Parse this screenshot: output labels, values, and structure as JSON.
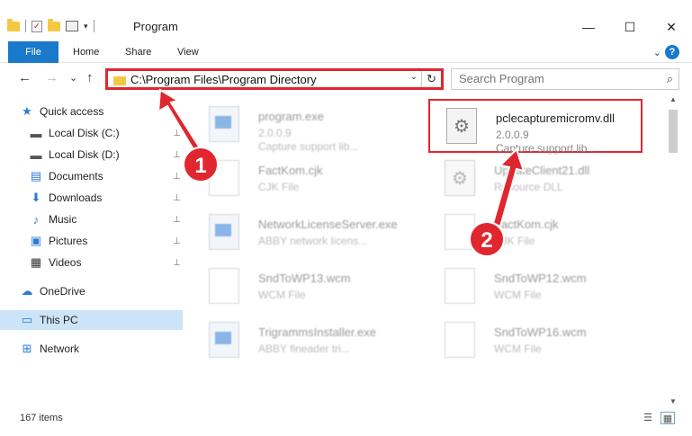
{
  "window": {
    "title": "Program",
    "minimize_glyph": "—",
    "maximize_glyph": "☐",
    "close_glyph": "✕"
  },
  "quick_access_toolbar": {
    "check_glyph": "✓",
    "dropdown_glyph": "▾"
  },
  "ribbon": {
    "tabs": [
      "File",
      "Home",
      "Share",
      "View"
    ],
    "expand_glyph": "⌄",
    "help_glyph": "?"
  },
  "nav": {
    "back_glyph": "←",
    "forward_glyph": "→",
    "recent_glyph": "⌄",
    "up_glyph": "↑"
  },
  "address": {
    "path": "C:\\Program Files\\Program Directory",
    "dropdown_glyph": "⌄",
    "refresh_glyph": "↻"
  },
  "search": {
    "placeholder": "Search Program",
    "icon_glyph": "⌕"
  },
  "sidebar": {
    "items": [
      {
        "label": "Quick access",
        "icon": "star-icon",
        "glyph": "★",
        "color": "#2a7bd3",
        "pinned": false
      },
      {
        "label": "Local Disk (C:)",
        "icon": "drive-icon",
        "glyph": "▬",
        "color": "#555555",
        "pinned": true
      },
      {
        "label": "Local Disk (D:)",
        "icon": "drive-icon",
        "glyph": "▬",
        "color": "#555555",
        "pinned": true
      },
      {
        "label": "Documents",
        "icon": "documents-icon",
        "glyph": "▤",
        "color": "#2a7bd3",
        "pinned": true
      },
      {
        "label": "Downloads",
        "icon": "download-icon",
        "glyph": "⬇",
        "color": "#2a7bd3",
        "pinned": true
      },
      {
        "label": "Music",
        "icon": "music-icon",
        "glyph": "♪",
        "color": "#2a7bd3",
        "pinned": true
      },
      {
        "label": "Pictures",
        "icon": "pictures-icon",
        "glyph": "▣",
        "color": "#2a7bd3",
        "pinned": true
      },
      {
        "label": "Videos",
        "icon": "videos-icon",
        "glyph": "▦",
        "color": "#333333",
        "pinned": true
      },
      {
        "label": "OneDrive",
        "icon": "cloud-icon",
        "glyph": "☁",
        "color": "#2a7bd3",
        "pinned": false
      },
      {
        "label": "This PC",
        "icon": "computer-icon",
        "glyph": "▭",
        "color": "#2a7bd3",
        "pinned": false
      },
      {
        "label": "Network",
        "icon": "network-icon",
        "glyph": "⊞",
        "color": "#2a7bd3",
        "pinned": false
      }
    ],
    "pin_glyph": "📌"
  },
  "files": [
    {
      "name": "program.exe",
      "meta1": "2.0.0.9",
      "meta2": "Capture support lib...",
      "kind": "exe"
    },
    {
      "name": "pclecapturemicromv.dll",
      "meta1": "2.0.0.9",
      "meta2": "Capture support lib...",
      "kind": "dll"
    },
    {
      "name": "FactKom.cjk",
      "meta1": "CJK File",
      "meta2": "",
      "kind": "doc"
    },
    {
      "name": "UpdateClient21.dll",
      "meta1": "Resource DLL",
      "meta2": "",
      "kind": "dll"
    },
    {
      "name": "NetworkLicenseServer.exe",
      "meta1": "ABBY network licens...",
      "meta2": "",
      "kind": "exe"
    },
    {
      "name": "FactKom.cjk",
      "meta1": "CJK File",
      "meta2": "",
      "kind": "doc"
    },
    {
      "name": "SndToWP13.wcm",
      "meta1": "WCM File",
      "meta2": "",
      "kind": "doc"
    },
    {
      "name": "SndToWP12.wcm",
      "meta1": "WCM File",
      "meta2": "",
      "kind": "doc"
    },
    {
      "name": "TrigrammsInstaller.exe",
      "meta1": "ABBY fineader tri...",
      "meta2": "",
      "kind": "exe"
    },
    {
      "name": "SndToWP16.wcm",
      "meta1": "WCM File",
      "meta2": "",
      "kind": "doc"
    }
  ],
  "gear_glyph": "⚙",
  "scrollbar": {
    "up_glyph": "▲",
    "down_glyph": "▼"
  },
  "status": {
    "item_count": "167 items",
    "details_view_glyph": "☰",
    "tiles_view_glyph": "▦"
  },
  "callouts": [
    "1",
    "2"
  ],
  "colors": {
    "accent": "#1979ca",
    "highlight_red": "#e0262f",
    "selection": "#cce4f7"
  }
}
